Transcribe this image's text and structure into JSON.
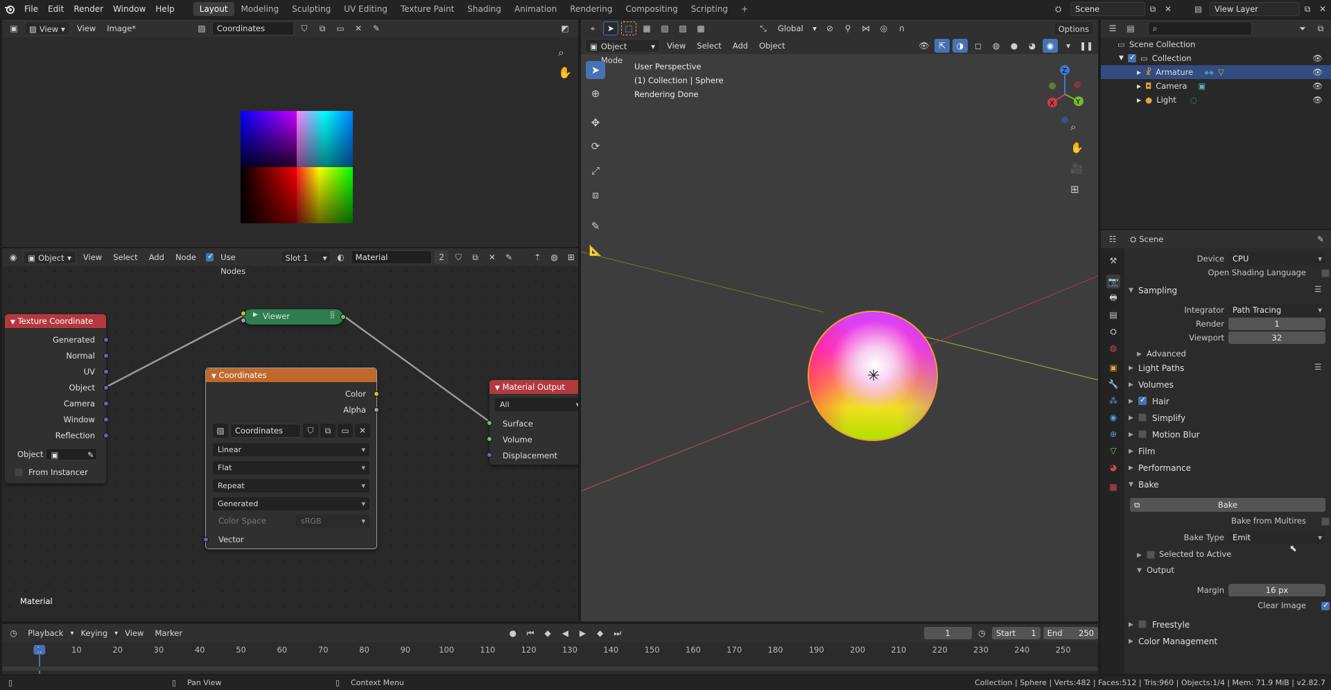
{
  "topbar": {
    "menus": [
      "File",
      "Edit",
      "Render",
      "Window",
      "Help"
    ],
    "workspaces": [
      "Layout",
      "Modeling",
      "Sculpting",
      "UV Editing",
      "Texture Paint",
      "Shading",
      "Animation",
      "Rendering",
      "Compositing",
      "Scripting"
    ],
    "active_workspace": "Layout",
    "add_tab": "+",
    "scene": "Scene",
    "view_layer": "View Layer"
  },
  "image_editor": {
    "view_menu": "View",
    "menus": [
      "View",
      "Image*"
    ],
    "image_name": "Coordinates"
  },
  "node_editor": {
    "object_mode": "Object",
    "menus": [
      "View",
      "Select",
      "Add",
      "Node"
    ],
    "use_nodes_label": "Use Nodes",
    "slot": "Slot 1",
    "material_name": "Material",
    "material_users": "2",
    "footer_label": "Material",
    "nodes": {
      "texcoord": {
        "title": "Texture Coordinate",
        "outputs": [
          "Generated",
          "Normal",
          "UV",
          "Object",
          "Camera",
          "Window",
          "Reflection"
        ],
        "object_label": "Object",
        "from_instancer": "From Instancer"
      },
      "viewer": {
        "title": "Viewer"
      },
      "coordinates": {
        "title": "Coordinates",
        "outputs": [
          "Color",
          "Alpha"
        ],
        "image_name": "Coordinates",
        "interpolation": "Linear",
        "projection": "Flat",
        "extension": "Repeat",
        "source": "Generated",
        "color_space_label": "Color Space",
        "color_space": "sRGB",
        "input": "Vector"
      },
      "output": {
        "title": "Material Output",
        "target": "All",
        "inputs": [
          "Surface",
          "Volume",
          "Displacement"
        ]
      }
    }
  },
  "viewport": {
    "mode": "Object Mode",
    "menus": [
      "View",
      "Select",
      "Add",
      "Object"
    ],
    "orientation": "Global",
    "options": "Options",
    "overlay_lines": [
      "User Perspective",
      "(1) Collection | Sphere",
      "Rendering Done"
    ],
    "gizmo_axes": [
      "X",
      "Y",
      "Z"
    ]
  },
  "outliner": {
    "search_placeholder": "",
    "scene_collection": "Scene Collection",
    "collection": "Collection",
    "items": [
      "Armature",
      "Camera",
      "Light"
    ]
  },
  "properties": {
    "context": "Scene",
    "device_label": "Device",
    "device": "CPU",
    "osl_label": "Open Shading Language",
    "sampling": "Sampling",
    "integrator_label": "Integrator",
    "integrator": "Path Tracing",
    "render_label": "Render",
    "render_samples": "1",
    "viewport_label": "Viewport",
    "viewport_samples": "32",
    "advanced": "Advanced",
    "light_paths": "Light Paths",
    "volumes": "Volumes",
    "hair": "Hair",
    "simplify": "Simplify",
    "motion_blur": "Motion Blur",
    "film": "Film",
    "performance": "Performance",
    "bake": "Bake",
    "bake_button": "Bake",
    "bake_from_multires": "Bake from Multires",
    "bake_type_label": "Bake Type",
    "bake_type": "Emit",
    "selected_to_active": "Selected to Active",
    "output": "Output",
    "margin_label": "Margin",
    "margin": "16 px",
    "clear_image": "Clear Image",
    "freestyle": "Freestyle",
    "color_management": "Color Management"
  },
  "timeline": {
    "menus": [
      "Playback",
      "Keying",
      "View",
      "Marker"
    ],
    "current_frame": "1",
    "start_label": "Start",
    "start": "1",
    "end_label": "End",
    "end": "250",
    "ticks": [
      "1",
      "10",
      "20",
      "30",
      "40",
      "50",
      "60",
      "70",
      "80",
      "90",
      "100",
      "110",
      "120",
      "130",
      "140",
      "150",
      "160",
      "170",
      "180",
      "190",
      "200",
      "210",
      "220",
      "230",
      "240",
      "250"
    ]
  },
  "statusbar": {
    "pan_view": "Pan View",
    "context_menu": "Context Menu",
    "stats": "Collection | Sphere | Verts:482 | Faces:512 | Tris:960 | Objects:1/4 | Mem: 71.9 MiB | v2.82.7"
  },
  "colors": {
    "accent": "#4772b3",
    "texcoord_header": "#b3393f",
    "viewer_header": "#2e7d4f",
    "coordinates_header": "#c0692b",
    "output_header": "#b3393f"
  }
}
